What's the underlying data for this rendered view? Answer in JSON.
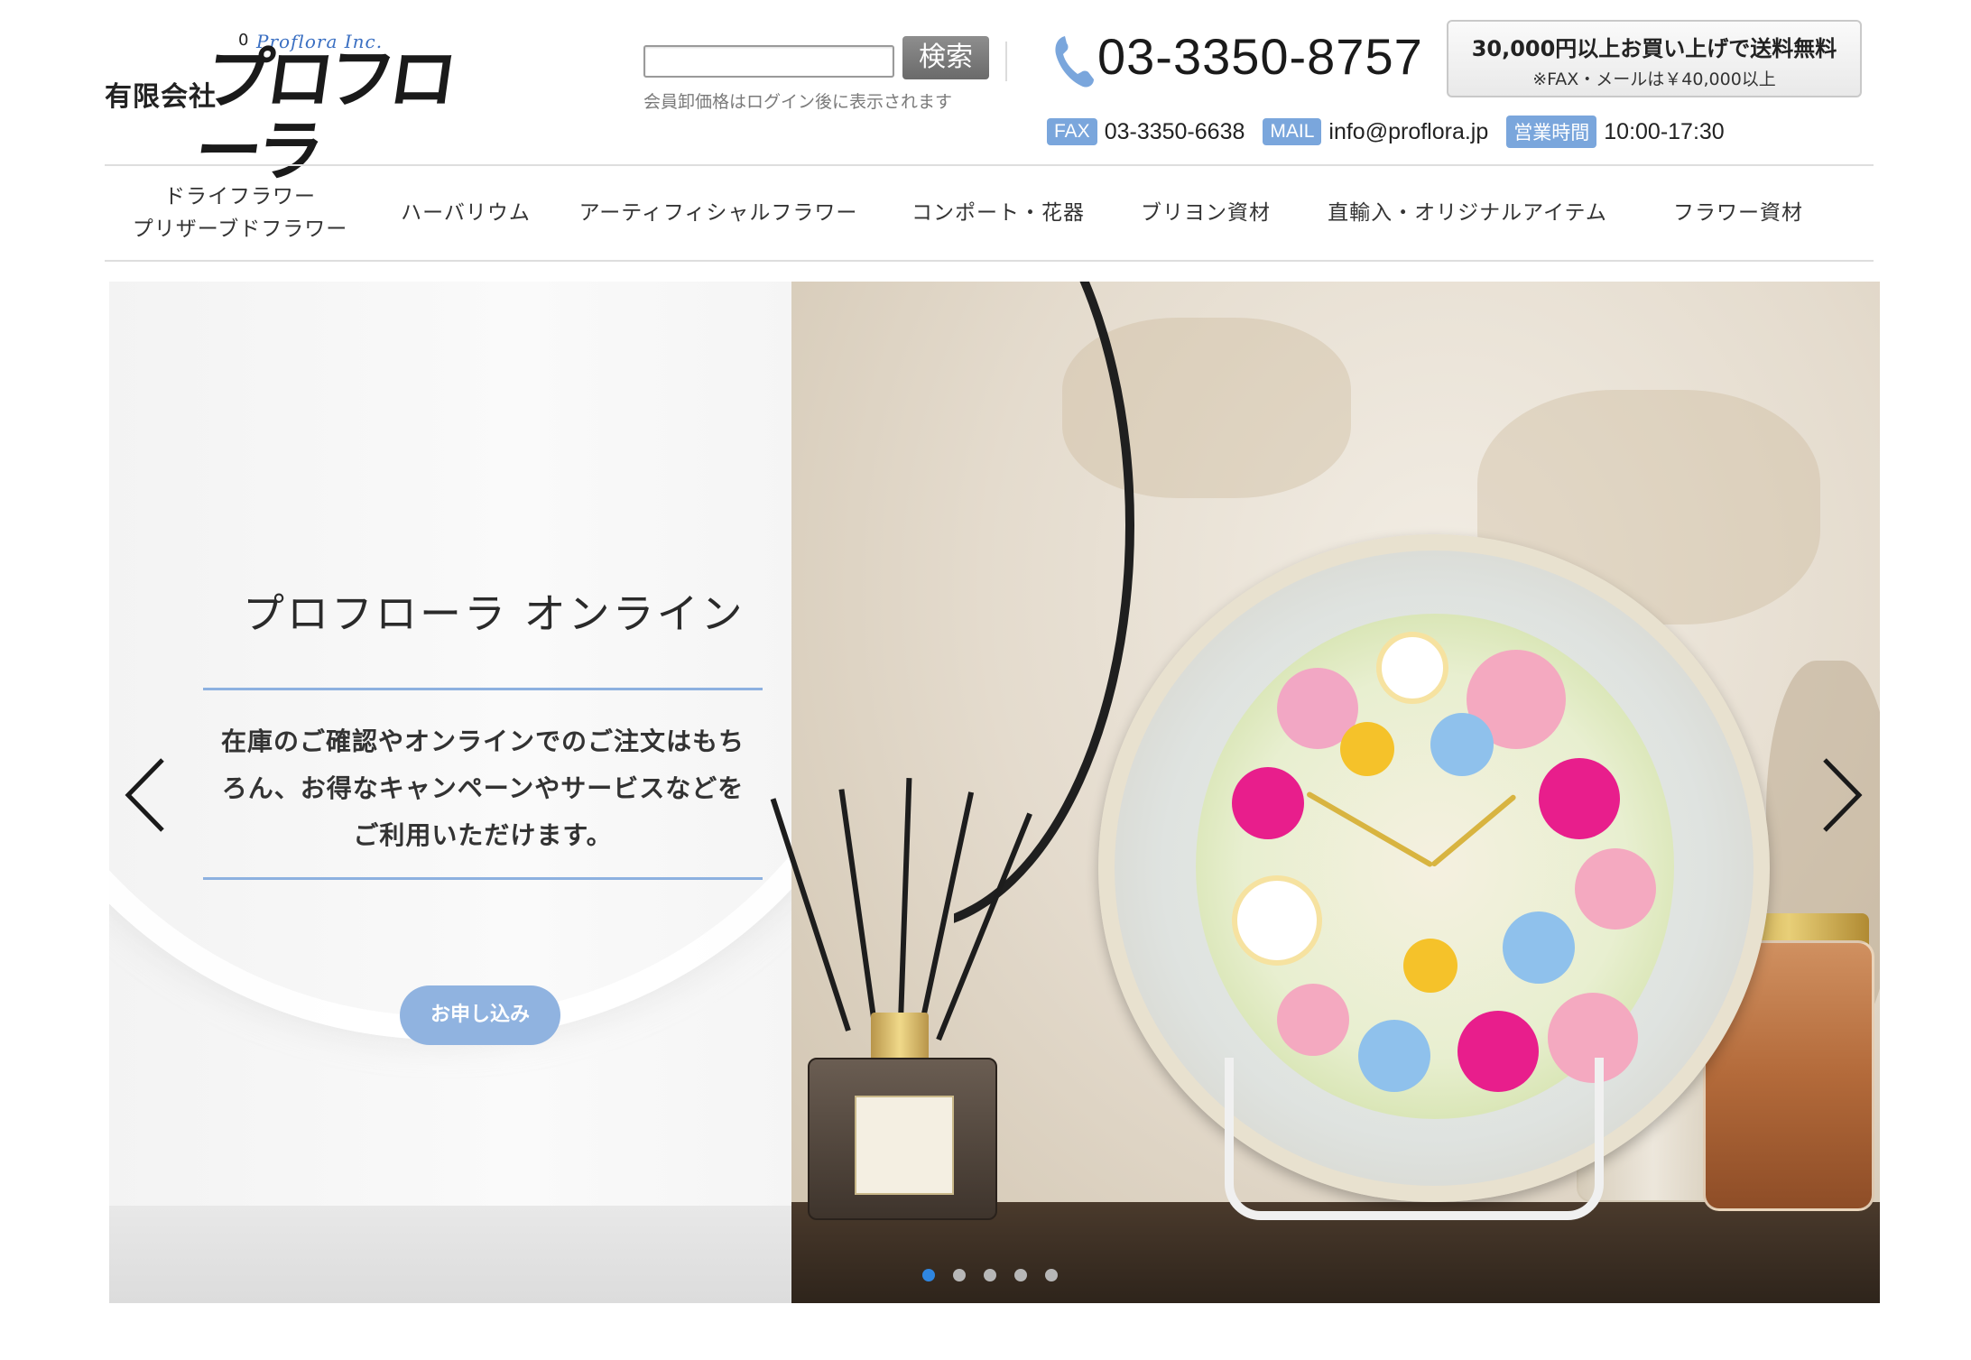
{
  "header": {
    "logo": {
      "prefix": "有限会社",
      "main": "プロフローラ",
      "sub": "Proflora Inc.",
      "mark": "0"
    },
    "search": {
      "button_label": "検索",
      "value": "",
      "note": "会員卸価格はログイン後に表示されます"
    },
    "phone": "03-3350-8757",
    "shipping": {
      "main": "30,000円以上お買い上げで送料無料",
      "sub": "※FAX・メールは￥40,000以上"
    },
    "contact": {
      "fax_tag": "FAX",
      "fax": "03-3350-6638",
      "mail_tag": "MAIL",
      "mail": "info@proflora.jp",
      "hours_tag": "営業時間",
      "hours": "10:00-17:30"
    }
  },
  "nav": {
    "items": [
      {
        "line1": "ドライフラワー",
        "line2": "プリザーブドフラワー"
      },
      {
        "line1": "ハーバリウム",
        "line2": ""
      },
      {
        "line1": "アーティフィシャルフラワー",
        "line2": ""
      },
      {
        "line1": "コンポート・花器",
        "line2": ""
      },
      {
        "line1": "ブリヨン資材",
        "line2": ""
      },
      {
        "line1": "直輸入・オリジナルアイテム",
        "line2": ""
      },
      {
        "line1": "フラワー資材",
        "line2": ""
      }
    ]
  },
  "hero": {
    "title": "プロフローラ オンライン",
    "copy_line1": "在庫のご確認やオンラインでのご注文はもち",
    "copy_line2": "ろん、お得なキャンペーンやサービスなどを",
    "copy_line3": "ご利用いただけます。",
    "cta_label": "お申し込み",
    "slide_count": 5,
    "active_slide": 1
  },
  "colors": {
    "accent": "#7aa6dc",
    "rule": "#8db1e0",
    "cta": "#90b3e0",
    "active_dot": "#2f86e0"
  },
  "icons": {
    "phone": "phone-icon",
    "prev": "chevron-left-icon",
    "next": "chevron-right-icon"
  }
}
